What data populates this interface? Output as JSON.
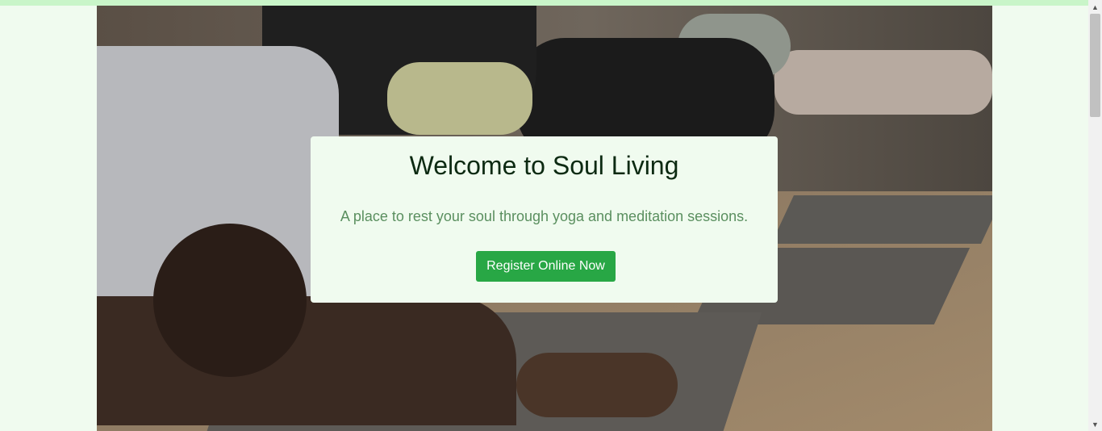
{
  "hero": {
    "title": "Welcome to Soul Living",
    "subtitle": "A place to rest your soul through yoga and meditation sessions.",
    "cta_label": "Register Online Now"
  },
  "colors": {
    "page_bg": "#f0fbef",
    "top_bar": "#c9f5c9",
    "button": "#28a745",
    "title": "#0c2a12",
    "subtitle": "#5a8f5f"
  },
  "icons": {
    "scroll_up": "▲",
    "scroll_down": "▼"
  }
}
